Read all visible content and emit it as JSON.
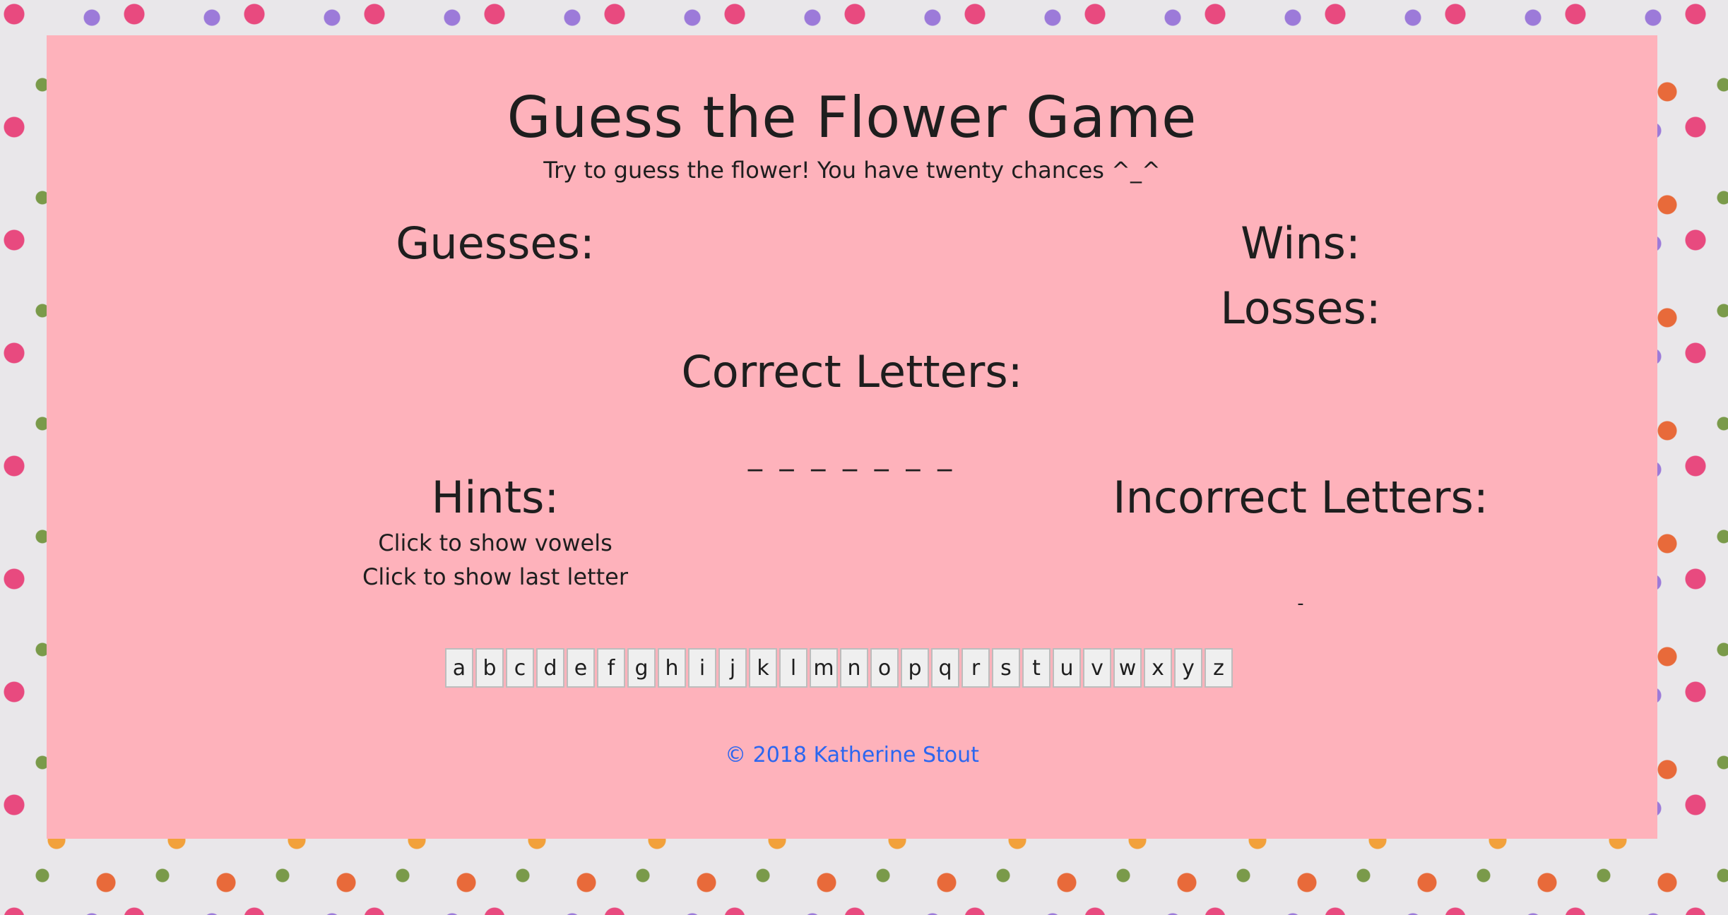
{
  "header": {
    "title": "Guess the Flower Game",
    "subtitle": "Try to guess the flower! You have twenty chances ^_^"
  },
  "stats": {
    "guesses_label": "Guesses:",
    "wins_label": "Wins:",
    "losses_label": "Losses:"
  },
  "word": {
    "correct_label": "Correct Letters:",
    "blanks": "_ _ _ _ _ _ _"
  },
  "hints": {
    "label": "Hints:",
    "show_vowels": "Click to show vowels",
    "show_last_letter": "Click to show last letter"
  },
  "incorrect": {
    "label": "Incorrect Letters:",
    "value": "-"
  },
  "keyboard": {
    "keys": [
      "a",
      "b",
      "c",
      "d",
      "e",
      "f",
      "g",
      "h",
      "i",
      "j",
      "k",
      "l",
      "m",
      "n",
      "o",
      "p",
      "q",
      "r",
      "s",
      "t",
      "u",
      "v",
      "w",
      "x",
      "y",
      "z"
    ]
  },
  "footer": {
    "copyright": "© 2018 Katherine Stout"
  },
  "colors": {
    "panel_bg": "#feb2bb",
    "footer_link": "#2b66f0",
    "key_bg": "#efefef"
  }
}
